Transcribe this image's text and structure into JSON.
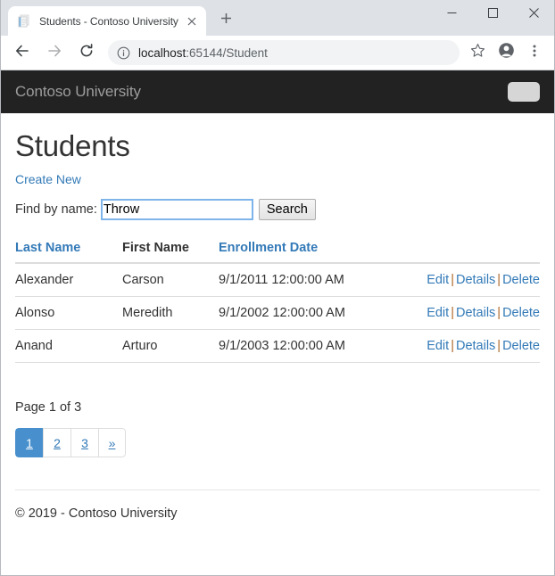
{
  "browser": {
    "tab": {
      "title": "Students - Contoso University",
      "favicon_icon": "document-icon",
      "close_icon": "close-icon"
    },
    "new_tab_icon": "plus-icon",
    "window_controls": {
      "minimize_icon": "minimize-icon",
      "maximize_icon": "maximize-icon",
      "close_icon": "close-icon"
    },
    "toolbar": {
      "back_icon": "back-arrow-icon",
      "forward_icon": "forward-arrow-icon",
      "reload_icon": "reload-icon",
      "info_icon": "info-circle-icon",
      "url_host": "localhost",
      "url_rest": ":65144/Student",
      "bookmark_icon": "star-icon",
      "profile_icon": "profile-avatar-icon",
      "menu_icon": "three-dot-menu-icon"
    }
  },
  "page": {
    "navbar": {
      "brand": "Contoso University",
      "toggler_icon": "navbar-toggler-icon"
    },
    "title": "Students",
    "create_new_label": "Create New",
    "search": {
      "label": "Find by name:",
      "value": "Throw",
      "placeholder": "",
      "button_label": "Search"
    },
    "table": {
      "columns": [
        {
          "label": "Last Name",
          "sortable": true
        },
        {
          "label": "First Name",
          "sortable": false
        },
        {
          "label": "Enrollment Date",
          "sortable": true
        },
        {
          "label": "",
          "sortable": false
        }
      ],
      "actions": {
        "edit": "Edit",
        "details": "Details",
        "delete": "Delete",
        "separator": "|"
      },
      "rows": [
        {
          "last_name": "Alexander",
          "first_name": "Carson",
          "enrollment_date": "9/1/2011 12:00:00 AM"
        },
        {
          "last_name": "Alonso",
          "first_name": "Meredith",
          "enrollment_date": "9/1/2002 12:00:00 AM"
        },
        {
          "last_name": "Anand",
          "first_name": "Arturo",
          "enrollment_date": "9/1/2003 12:00:00 AM"
        }
      ]
    },
    "page_info": "Page 1 of 3",
    "pagination": {
      "items": [
        {
          "label": "1",
          "active": true
        },
        {
          "label": "2",
          "active": false
        },
        {
          "label": "3",
          "active": false
        },
        {
          "label": "»",
          "active": false
        }
      ]
    },
    "footer": "© 2019 - Contoso University"
  },
  "colors": {
    "link": "#337ab7",
    "navbar_bg": "#222222",
    "navbar_brand": "#9d9d9d",
    "pagination_active": "#4890cd",
    "focus_border": "#7eb4ea",
    "browser_chrome": "#dee1e6"
  }
}
